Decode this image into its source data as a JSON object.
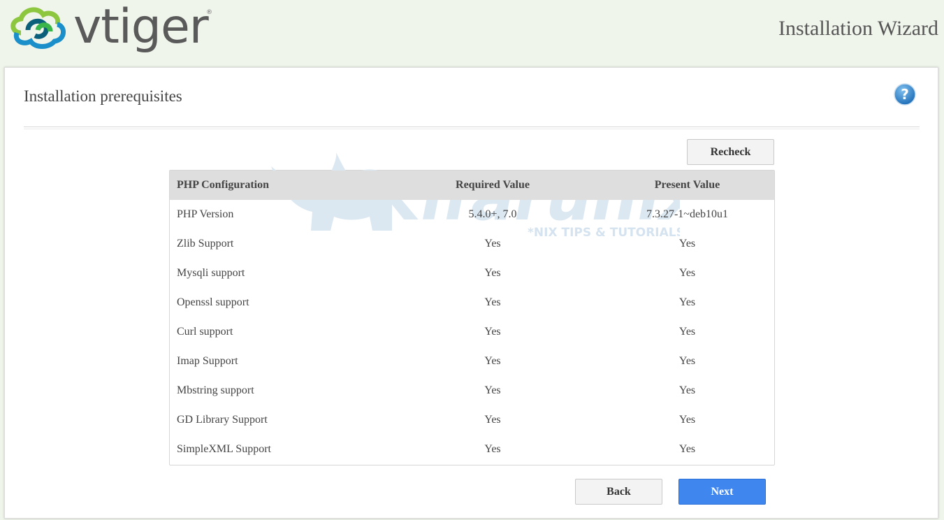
{
  "header": {
    "logo_text": "vtiger",
    "logo_tm": "®",
    "wizard_title": "Installation Wizard"
  },
  "panel": {
    "title": "Installation prerequisites",
    "help_icon": "question-circle-icon",
    "recheck_label": "Recheck"
  },
  "table": {
    "headers": [
      "PHP Configuration",
      "Required Value",
      "Present Value"
    ],
    "rows": [
      [
        "PHP Version",
        "5.4.0+, 7.0",
        "7.3.27-1~deb10u1"
      ],
      [
        "Zlib Support",
        "Yes",
        "Yes"
      ],
      [
        "Mysqli support",
        "Yes",
        "Yes"
      ],
      [
        "Openssl support",
        "Yes",
        "Yes"
      ],
      [
        "Curl support",
        "Yes",
        "Yes"
      ],
      [
        "Imap Support",
        "Yes",
        "Yes"
      ],
      [
        "Mbstring support",
        "Yes",
        "Yes"
      ],
      [
        "GD Library Support",
        "Yes",
        "Yes"
      ],
      [
        "SimpleXML Support",
        "Yes",
        "Yes"
      ]
    ]
  },
  "watermark": {
    "text": "Kifarunix",
    "tagline": "*NIX TIPS & TUTORIALS"
  },
  "footer": {
    "back_label": "Back",
    "next_label": "Next"
  },
  "colors": {
    "page_bg": "#f0f5ec",
    "primary_button": "#3f86ee",
    "table_header_bg": "#dedede",
    "watermark": "#dbe8f2"
  }
}
